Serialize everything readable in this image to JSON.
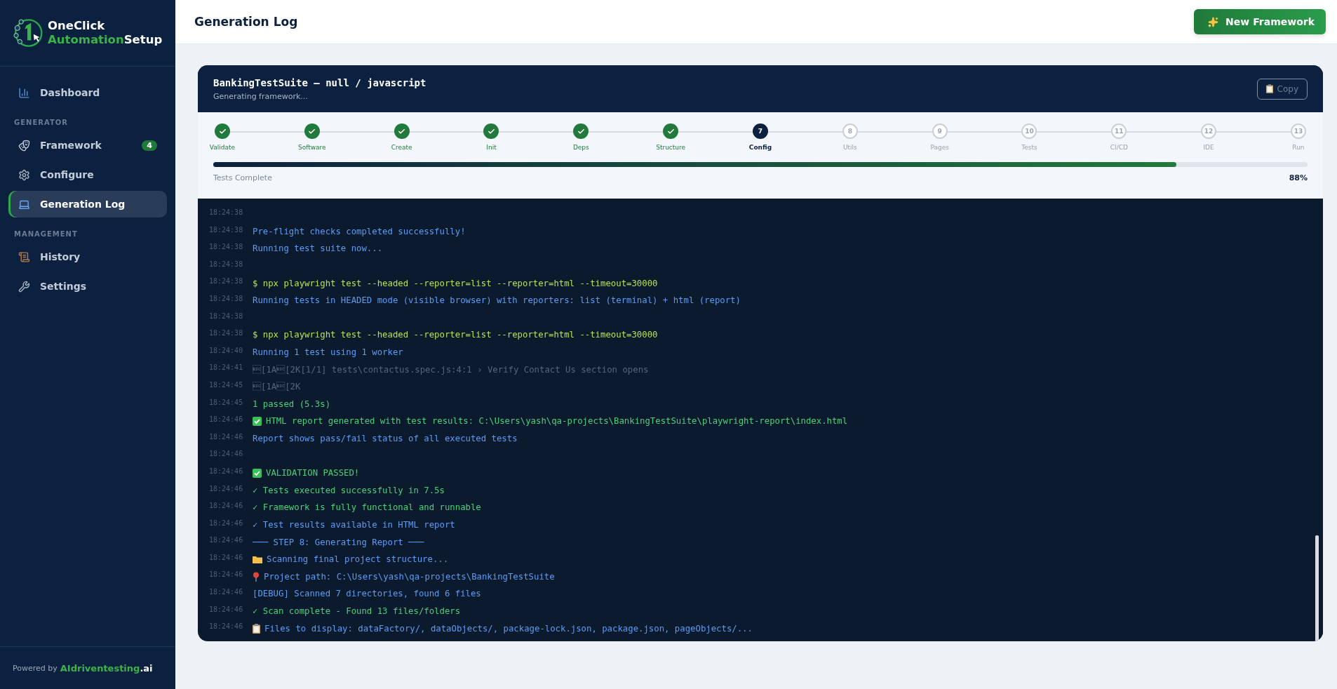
{
  "brand": {
    "line1": "OneClick",
    "line2_accent": "Automation",
    "line2_rest": "Setup"
  },
  "sidebar": {
    "items": [
      {
        "kind": "item",
        "label": "Dashboard",
        "selected": false
      },
      {
        "kind": "section",
        "label": "GENERATOR"
      },
      {
        "kind": "item",
        "label": "Framework",
        "selected": false,
        "badge": "4"
      },
      {
        "kind": "item",
        "label": "Configure",
        "selected": false
      },
      {
        "kind": "item",
        "label": "Generation Log",
        "selected": true
      },
      {
        "kind": "section",
        "label": "MANAGEMENT"
      },
      {
        "kind": "item",
        "label": "History",
        "selected": false
      },
      {
        "kind": "item",
        "label": "Settings",
        "selected": false
      }
    ],
    "footer": {
      "prefix": "Powered by",
      "accent": "AIdriventesting",
      "suffix": ".ai"
    }
  },
  "header": {
    "title": "Generation Log",
    "button": "New Framework"
  },
  "card": {
    "title": "BankingTestSuite — null / javascript",
    "subtitle": "Generating framework...",
    "copy_button": "Copy"
  },
  "steps": [
    {
      "label": "Validate",
      "kind": "done"
    },
    {
      "label": "Software",
      "kind": "done"
    },
    {
      "label": "Create",
      "kind": "done"
    },
    {
      "label": "Init",
      "kind": "done"
    },
    {
      "label": "Deps",
      "kind": "done"
    },
    {
      "label": "Structure",
      "kind": "done"
    },
    {
      "number": "7",
      "label": "Config",
      "kind": "current"
    },
    {
      "number": "8",
      "label": "Utils",
      "kind": "pending"
    },
    {
      "number": "9",
      "label": "Pages",
      "kind": "pending"
    },
    {
      "number": "10",
      "label": "Tests",
      "kind": "pending"
    },
    {
      "number": "11",
      "label": "CI/CD",
      "kind": "pending"
    },
    {
      "number": "12",
      "label": "IDE",
      "kind": "pending"
    },
    {
      "number": "13",
      "label": "Run",
      "kind": "pending"
    }
  ],
  "progress": {
    "label": "Tests Complete",
    "level": 0.88,
    "percent": "88%"
  },
  "log": [
    {
      "time": "18:24:38",
      "kind": "blank"
    },
    {
      "time": "18:24:38",
      "kind": "info",
      "text": "Pre-flight checks completed successfully!"
    },
    {
      "time": "18:24:38",
      "kind": "info",
      "text": "Running test suite now..."
    },
    {
      "time": "18:24:38",
      "kind": "blank"
    },
    {
      "time": "18:24:38",
      "kind": "command",
      "text": "$ npx playwright test --headed --reporter=list --reporter=html --timeout=30000"
    },
    {
      "time": "18:24:38",
      "kind": "info",
      "text": "Running tests in HEADED mode (visible browser) with reporters: list (terminal) + html (report)"
    },
    {
      "time": "18:24:38",
      "kind": "blank"
    },
    {
      "time": "18:24:38",
      "kind": "command",
      "text": "$ npx playwright test --headed --reporter=list --reporter=html --timeout=30000"
    },
    {
      "time": "18:24:40",
      "kind": "info",
      "text": "Running 1 test using 1 worker"
    },
    {
      "time": "18:24:41",
      "kind": "muted",
      "text": "\u001b[1A\u001b[2K[1/1] tests\\contactus.spec.js:4:1 › Verify Contact Us section opens"
    },
    {
      "time": "18:24:45",
      "kind": "muted",
      "text": "\u001b[1A\u001b[2K"
    },
    {
      "time": "18:24:45",
      "kind": "success",
      "text": "1 passed (5.3s)"
    },
    {
      "time": "18:24:46",
      "kind": "success",
      "text": "HTML report generated with test results: C:\\Users\\yash\\qa-projects\\BankingTestSuite\\playwright-report\\index.html"
    },
    {
      "time": "18:24:46",
      "kind": "info",
      "text": "Report shows pass/fail status of all executed tests"
    },
    {
      "time": "18:24:46",
      "kind": "blank"
    },
    {
      "time": "18:24:46",
      "kind": "success",
      "text": "VALIDATION PASSED!"
    },
    {
      "time": "18:24:46",
      "kind": "success",
      "text": "✓ Tests executed successfully in 7.5s"
    },
    {
      "time": "18:24:46",
      "kind": "success",
      "text": "✓ Framework is fully functional and runnable"
    },
    {
      "time": "18:24:46",
      "kind": "info",
      "text": "✓ Test results available in HTML report"
    },
    {
      "time": "18:24:46",
      "kind": "info",
      "text": "─── STEP 8: Generating Report ───"
    },
    {
      "time": "18:24:46",
      "kind": "info",
      "text": "Scanning final project structure..."
    },
    {
      "time": "18:24:46",
      "kind": "info",
      "text": "Project path: C:\\Users\\yash\\qa-projects\\BankingTestSuite"
    },
    {
      "time": "18:24:46",
      "kind": "info",
      "text": "[DEBUG] Scanned 7 directories, found 6 files"
    },
    {
      "time": "18:24:46",
      "kind": "success",
      "text": "✓ Scan complete - Found 13 files/folders"
    },
    {
      "time": "18:24:46",
      "kind": "info",
      "text": "Files to display: dataFactory/, dataObjects/, package-lock.json, package.json, pageObjects/..."
    }
  ]
}
